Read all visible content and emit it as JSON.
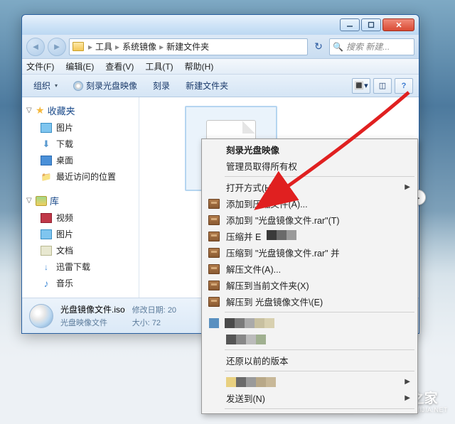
{
  "breadcrumb": {
    "seg1": "工具",
    "seg2": "系统镜像",
    "seg3": "新建文件夹"
  },
  "search": {
    "placeholder": "搜索 新建..."
  },
  "menu": {
    "file": "文件(F)",
    "edit": "编辑(E)",
    "view": "查看(V)",
    "tools": "工具(T)",
    "help": "帮助(H)"
  },
  "toolbar": {
    "org": "组织",
    "burn_img": "刻录光盘映像",
    "burn": "刻录",
    "new_folder": "新建文件夹"
  },
  "sidebar": {
    "fav": "收藏夹",
    "fav_items": {
      "pictures": "图片",
      "downloads": "下载",
      "desktop": "桌面",
      "recent": "最近访问的位置"
    },
    "lib": "库",
    "lib_items": {
      "videos": "视频",
      "pictures": "图片",
      "documents": "文档",
      "thunder": "迅雷下载",
      "music": "音乐"
    }
  },
  "detail": {
    "filename": "光盘镜像文件.iso",
    "filetype": "光盘映像文件",
    "mod_label": "修改日期:",
    "mod_value": "20",
    "size_label": "大小:",
    "size_value": "72"
  },
  "context": {
    "burn": "刻录光盘映像",
    "admin": "管理员取得所有权",
    "open_with": "打开方式(H)",
    "add_archive": "添加到压缩文件(A)...",
    "add_rar": "添加到 \"光盘镜像文件.rar\"(T)",
    "compress_and": "压缩并 E",
    "compress_to": "压缩到 \"光盘镜像文件.rar\" 并",
    "extract": "解压文件(A)...",
    "extract_here": "解压到当前文件夹(X)",
    "extract_to": "解压到 光盘镜像文件\\(E)",
    "restore": "还原以前的版本",
    "send_to": "发送到(N)"
  },
  "watermark": {
    "cn": "系统之家",
    "en": "XITONGZHIJIA.NET"
  }
}
